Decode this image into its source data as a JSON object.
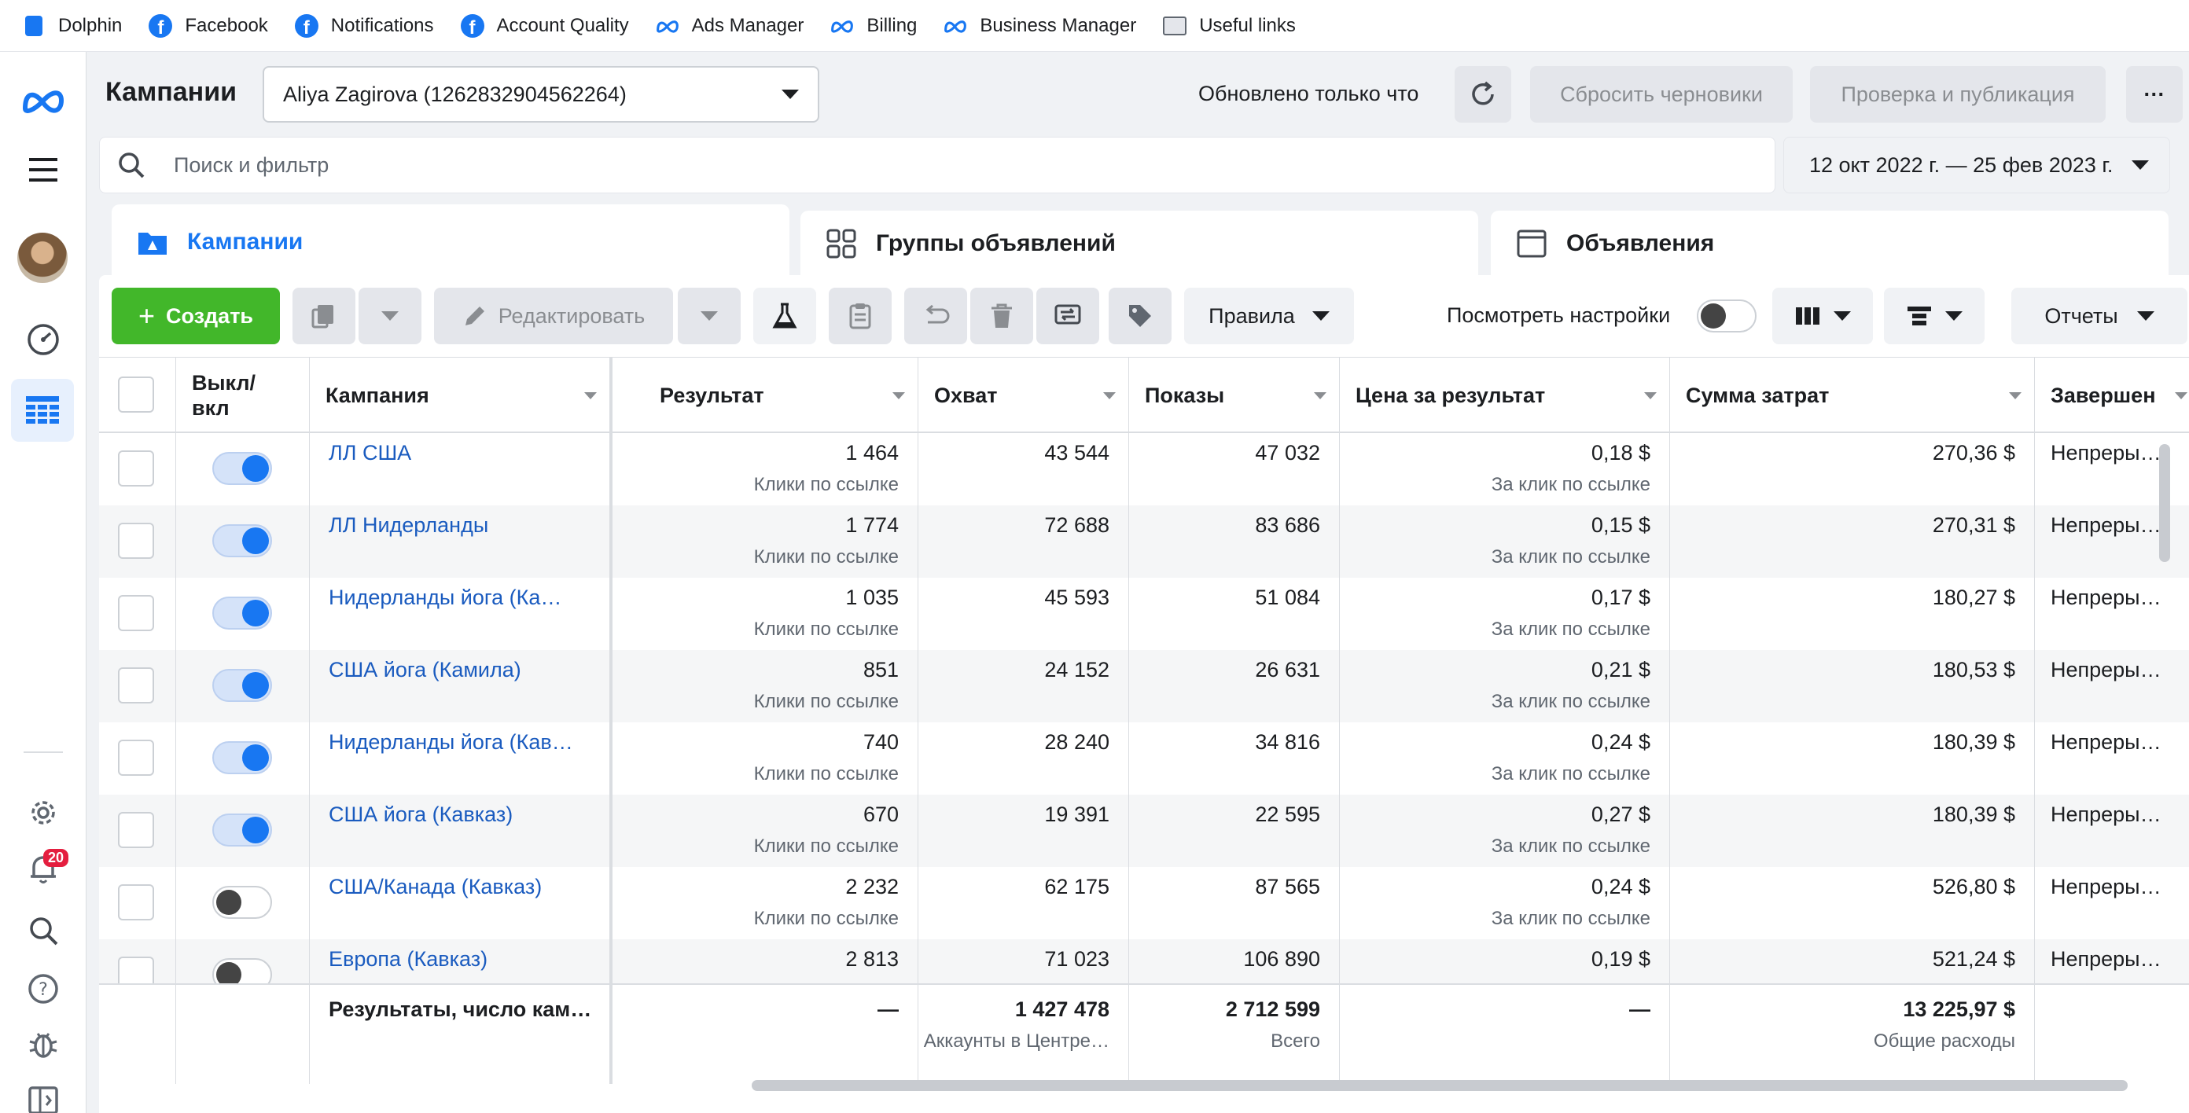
{
  "bookmarks": [
    {
      "label": "Dolphin",
      "icon": "dolphin-icon"
    },
    {
      "label": "Facebook",
      "icon": "facebook-icon"
    },
    {
      "label": "Notifications",
      "icon": "facebook-icon"
    },
    {
      "label": "Account Quality",
      "icon": "facebook-icon"
    },
    {
      "label": "Ads Manager",
      "icon": "meta-icon"
    },
    {
      "label": "Billing",
      "icon": "meta-icon"
    },
    {
      "label": "Business Manager",
      "icon": "meta-icon"
    },
    {
      "label": "Useful links",
      "icon": "folder-icon"
    }
  ],
  "rail": {
    "notification_count": "20"
  },
  "header": {
    "title": "Кампании",
    "account": "Aliya Zagirova (1262832904562264)",
    "updated": "Обновлено только что",
    "reset_drafts": "Сбросить черновики",
    "review_publish": "Проверка и публикация",
    "more": "···"
  },
  "search": {
    "placeholder": "Поиск и фильтр"
  },
  "date_range": "12 окт 2022 г. — 25 фев 2023 г.",
  "tabs": [
    {
      "label": "Кампании",
      "active": true
    },
    {
      "label": "Группы объявлений",
      "active": false
    },
    {
      "label": "Объявления",
      "active": false
    }
  ],
  "toolbar": {
    "create": "Создать",
    "edit": "Редактировать",
    "rules": "Правила",
    "view_settings": "Посмотреть настройки",
    "reports": "Отчеты"
  },
  "table": {
    "columns": {
      "toggle": "Выкл/\nвкл",
      "campaign": "Кампания",
      "result": "Результат",
      "reach": "Охват",
      "impressions": "Показы",
      "cost_per_result": "Цена за результат",
      "amount_spent": "Сумма затрат",
      "ends": "Завершен"
    },
    "rows": [
      {
        "on": true,
        "name": "ЛЛ США",
        "result": "1 464",
        "result_sub": "Клики по ссылке",
        "reach": "43 544",
        "impressions": "47 032",
        "cpr": "0,18 $",
        "cpr_sub": "За клик по ссылке",
        "spent": "270,36 $",
        "ends": "Непреры…"
      },
      {
        "on": true,
        "name": "ЛЛ Нидерланды",
        "result": "1 774",
        "result_sub": "Клики по ссылке",
        "reach": "72 688",
        "impressions": "83 686",
        "cpr": "0,15 $",
        "cpr_sub": "За клик по ссылке",
        "spent": "270,31 $",
        "ends": "Непреры…"
      },
      {
        "on": true,
        "name": "Нидерланды йога (Ка…",
        "result": "1 035",
        "result_sub": "Клики по ссылке",
        "reach": "45 593",
        "impressions": "51 084",
        "cpr": "0,17 $",
        "cpr_sub": "За клик по ссылке",
        "spent": "180,27 $",
        "ends": "Непреры…"
      },
      {
        "on": true,
        "name": "США йога (Камила)",
        "result": "851",
        "result_sub": "Клики по ссылке",
        "reach": "24 152",
        "impressions": "26 631",
        "cpr": "0,21 $",
        "cpr_sub": "За клик по ссылке",
        "spent": "180,53 $",
        "ends": "Непреры…"
      },
      {
        "on": true,
        "name": "Нидерланды йога (Кав…",
        "result": "740",
        "result_sub": "Клики по ссылке",
        "reach": "28 240",
        "impressions": "34 816",
        "cpr": "0,24 $",
        "cpr_sub": "За клик по ссылке",
        "spent": "180,39 $",
        "ends": "Непреры…"
      },
      {
        "on": true,
        "name": "США йога (Кавказ)",
        "result": "670",
        "result_sub": "Клики по ссылке",
        "reach": "19 391",
        "impressions": "22 595",
        "cpr": "0,27 $",
        "cpr_sub": "За клик по ссылке",
        "spent": "180,39 $",
        "ends": "Непреры…"
      },
      {
        "on": false,
        "name": "США/Канада (Кавказ)",
        "result": "2 232",
        "result_sub": "Клики по ссылке",
        "reach": "62 175",
        "impressions": "87 565",
        "cpr": "0,24 $",
        "cpr_sub": "За клик по ссылке",
        "spent": "526,80 $",
        "ends": "Непреры…"
      },
      {
        "on": false,
        "name": "Европа (Кавказ)",
        "result": "2 813",
        "result_sub": "",
        "reach": "71 023",
        "impressions": "106 890",
        "cpr": "0,19 $",
        "cpr_sub": "",
        "spent": "521,24 $",
        "ends": "Непреры…"
      }
    ],
    "footer": {
      "label": "Результаты, число кам…",
      "result": "—",
      "reach": "1 427 478",
      "reach_sub": "Аккаунты в Центре…",
      "impressions": "2 712 599",
      "impressions_sub": "Всего",
      "cpr": "—",
      "spent": "13 225,97 $",
      "spent_sub": "Общие расходы"
    }
  }
}
